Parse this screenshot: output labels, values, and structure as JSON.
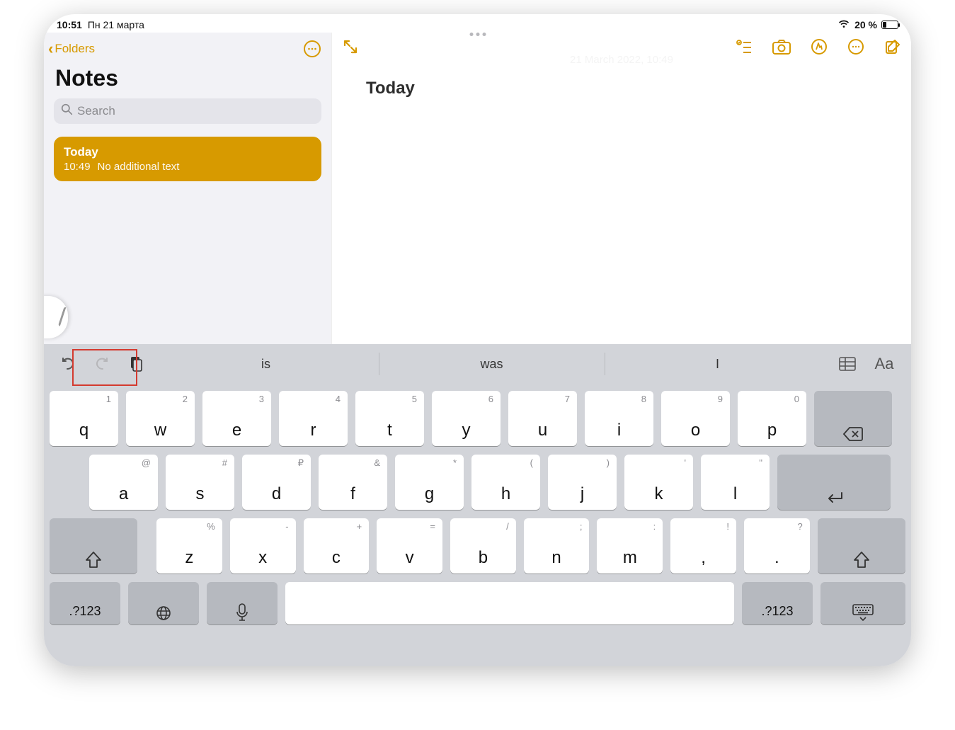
{
  "status": {
    "time": "10:51",
    "date": "Пн 21 марта",
    "battery_pct": "20 %"
  },
  "sidebar": {
    "back_label": "Folders",
    "title": "Notes",
    "search_placeholder": "Search",
    "note": {
      "title": "Today",
      "time": "10:49",
      "preview": "No additional text"
    }
  },
  "note_pane": {
    "timestamp_ghost": "21 March 2022, 10:49",
    "body_title": "Today"
  },
  "keyboard": {
    "predictions": [
      "is",
      "was",
      "I"
    ],
    "row1": [
      {
        "main": "q",
        "sec": "1"
      },
      {
        "main": "w",
        "sec": "2"
      },
      {
        "main": "e",
        "sec": "3"
      },
      {
        "main": "r",
        "sec": "4"
      },
      {
        "main": "t",
        "sec": "5"
      },
      {
        "main": "y",
        "sec": "6"
      },
      {
        "main": "u",
        "sec": "7"
      },
      {
        "main": "i",
        "sec": "8"
      },
      {
        "main": "o",
        "sec": "9"
      },
      {
        "main": "p",
        "sec": "0"
      }
    ],
    "row2": [
      {
        "main": "a",
        "sec": "@"
      },
      {
        "main": "s",
        "sec": "#"
      },
      {
        "main": "d",
        "sec": "₽"
      },
      {
        "main": "f",
        "sec": "&"
      },
      {
        "main": "g",
        "sec": "*"
      },
      {
        "main": "h",
        "sec": "("
      },
      {
        "main": "j",
        "sec": ")"
      },
      {
        "main": "k",
        "sec": "'"
      },
      {
        "main": "l",
        "sec": "\""
      }
    ],
    "row3": [
      {
        "main": "z",
        "sec": "%"
      },
      {
        "main": "x",
        "sec": "-"
      },
      {
        "main": "c",
        "sec": "+"
      },
      {
        "main": "v",
        "sec": "="
      },
      {
        "main": "b",
        "sec": "/"
      },
      {
        "main": "n",
        "sec": ";"
      },
      {
        "main": "m",
        "sec": ":"
      },
      {
        "main": ",",
        "sec": "!"
      },
      {
        "main": ".",
        "sec": "?"
      }
    ],
    "fn_label": ".?123"
  }
}
